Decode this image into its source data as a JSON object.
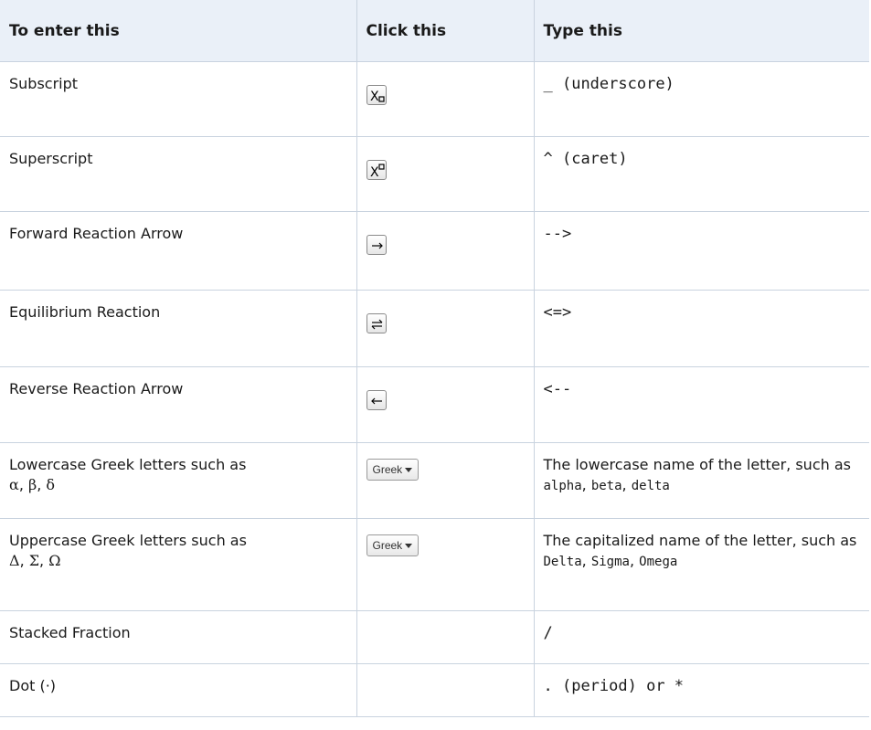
{
  "headers": {
    "col1": "To enter this",
    "col2": "Click this",
    "col3": "Type this"
  },
  "rows": [
    {
      "label": "Subscript",
      "button_icon": "subscript-icon",
      "type": "_ (underscore)"
    },
    {
      "label": "Superscript",
      "button_icon": "superscript-icon",
      "type": "^ (caret)"
    },
    {
      "label": "Forward Reaction Arrow",
      "button_icon": "right-arrow-icon",
      "type": "-->"
    },
    {
      "label": "Equilibrium Reaction",
      "button_icon": "equilibrium-arrows-icon",
      "type": "<=>"
    },
    {
      "label": "Reverse Reaction Arrow",
      "button_icon": "left-arrow-icon",
      "type": "<--"
    },
    {
      "label": "Lowercase Greek letters such as",
      "label_symbols": [
        "α",
        "β",
        "δ"
      ],
      "button_label": "Greek",
      "type_text": "The lowercase name of the letter, such as",
      "type_examples": [
        "alpha",
        "beta",
        "delta"
      ]
    },
    {
      "label": "Uppercase Greek letters such as",
      "label_symbols": [
        "Δ",
        "Σ",
        "Ω"
      ],
      "button_label": "Greek",
      "type_text": "The capitalized name of the letter, such as",
      "type_examples": [
        "Delta",
        "Sigma",
        "Omega"
      ]
    },
    {
      "label": "Stacked Fraction",
      "type": "/"
    },
    {
      "label": "Dot (·)",
      "type": ". (period) or *"
    }
  ],
  "colors": {
    "header_background": "#eaf0f8",
    "border": "#c9d3df"
  }
}
